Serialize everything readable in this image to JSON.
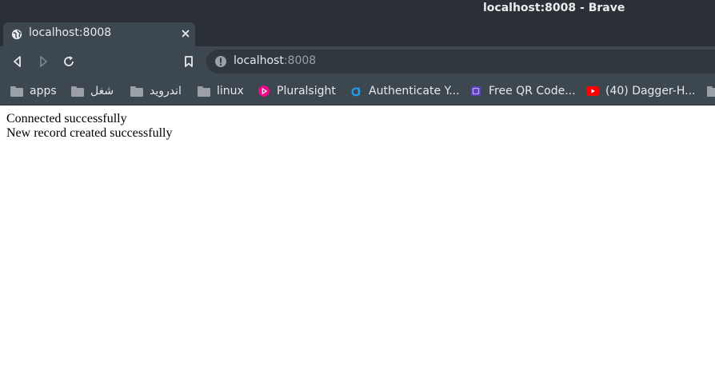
{
  "window": {
    "title": "localhost:8008 - Brave"
  },
  "tab": {
    "title": "localhost:8008",
    "favicon": "globe-icon"
  },
  "toolbar": {
    "url_host": "localhost",
    "url_port": ":8008"
  },
  "bookmarks": [
    {
      "label": "apps",
      "icon": "folder-icon"
    },
    {
      "label": "شغل",
      "icon": "folder-icon"
    },
    {
      "label": "اندروید",
      "icon": "folder-icon"
    },
    {
      "label": "linux",
      "icon": "folder-icon"
    },
    {
      "label": "Pluralsight",
      "icon": "pluralsight-icon"
    },
    {
      "label": "Authenticate Y...",
      "icon": "auth-icon"
    },
    {
      "label": "Free QR Code...",
      "icon": "qr-icon"
    },
    {
      "label": "(40) Dagger-H...",
      "icon": "youtube-icon"
    }
  ],
  "page": {
    "line1": "Connected successfully",
    "line2": "New record created successfully"
  },
  "colors": {
    "titlebar": "#2b3036",
    "toolbar": "#3c474f",
    "text_light": "#e8eaed"
  }
}
